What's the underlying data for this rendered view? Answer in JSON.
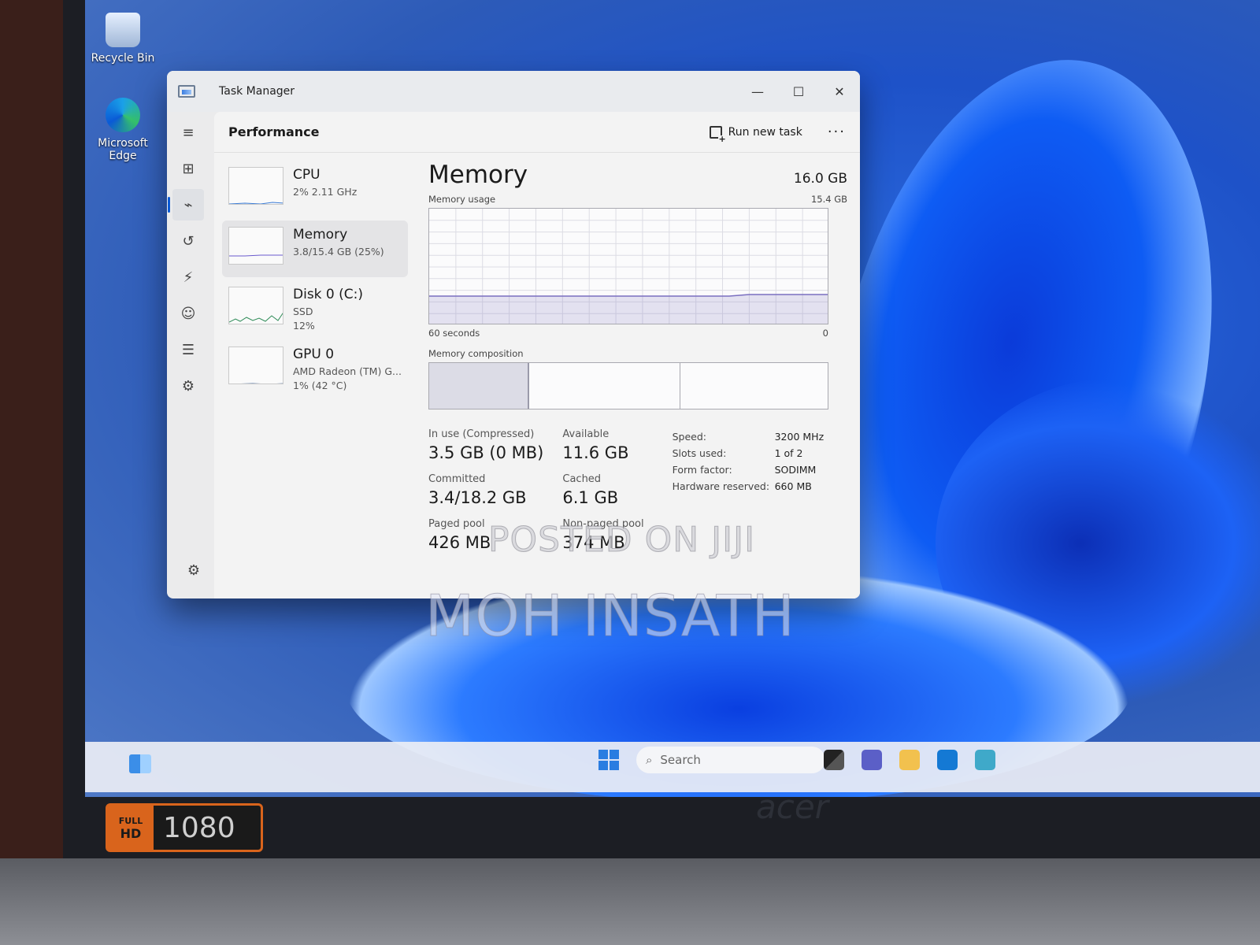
{
  "desktop": {
    "icons": [
      {
        "label": "Recycle Bin"
      },
      {
        "label": "Microsoft Edge"
      }
    ]
  },
  "window": {
    "title": "Task Manager",
    "controls": {
      "minimize": "—",
      "maximize": "☐",
      "close": "✕"
    }
  },
  "header": {
    "title": "Performance",
    "run_new_task": "Run new task",
    "more": "···"
  },
  "resources": [
    {
      "name": "CPU",
      "sub1": "2% 2.11 GHz",
      "sub2": "",
      "sub3": ""
    },
    {
      "name": "Memory",
      "sub1": "3.8/15.4 GB (25%)",
      "sub2": "",
      "sub3": ""
    },
    {
      "name": "Disk 0 (C:)",
      "sub1": "SSD",
      "sub2": "12%",
      "sub3": ""
    },
    {
      "name": "GPU 0",
      "sub1": "AMD Radeon (TM) G...",
      "sub2": "1% (42 °C)",
      "sub3": ""
    }
  ],
  "memory": {
    "title": "Memory",
    "total": "16.0 GB",
    "usage_label": "Memory usage",
    "usage_max": "15.4 GB",
    "time_label": "60 seconds",
    "min_label": "0",
    "composition_label": "Memory composition",
    "usage_fraction": 0.25,
    "stats": {
      "in_use_label": "In use (Compressed)",
      "in_use_value": "3.5 GB (0 MB)",
      "available_label": "Available",
      "available_value": "11.6 GB",
      "committed_label": "Committed",
      "committed_value": "3.4/18.2 GB",
      "cached_label": "Cached",
      "cached_value": "6.1 GB",
      "paged_label": "Paged pool",
      "paged_value": "426 MB",
      "nonpaged_label": "Non-paged pool",
      "nonpaged_value": "374 MB"
    },
    "specs": [
      {
        "key": "Speed:",
        "value": "3200 MHz"
      },
      {
        "key": "Slots used:",
        "value": "1 of 2"
      },
      {
        "key": "Form factor:",
        "value": "SODIMM"
      },
      {
        "key": "Hardware reserved:",
        "value": "660 MB"
      }
    ]
  },
  "taskbar": {
    "search_placeholder": "Search"
  },
  "watermarks": {
    "line1": "POSTED ON JIJI",
    "line2": "MOH INSATH"
  },
  "hardware": {
    "badge_top": "FULL",
    "badge_bottom": "HD",
    "badge_res": "1080",
    "brand": "acer"
  },
  "colors": {
    "accent": "#0a5ad6",
    "wallpaper": "#1e52c8",
    "badge": "#d9641c"
  }
}
